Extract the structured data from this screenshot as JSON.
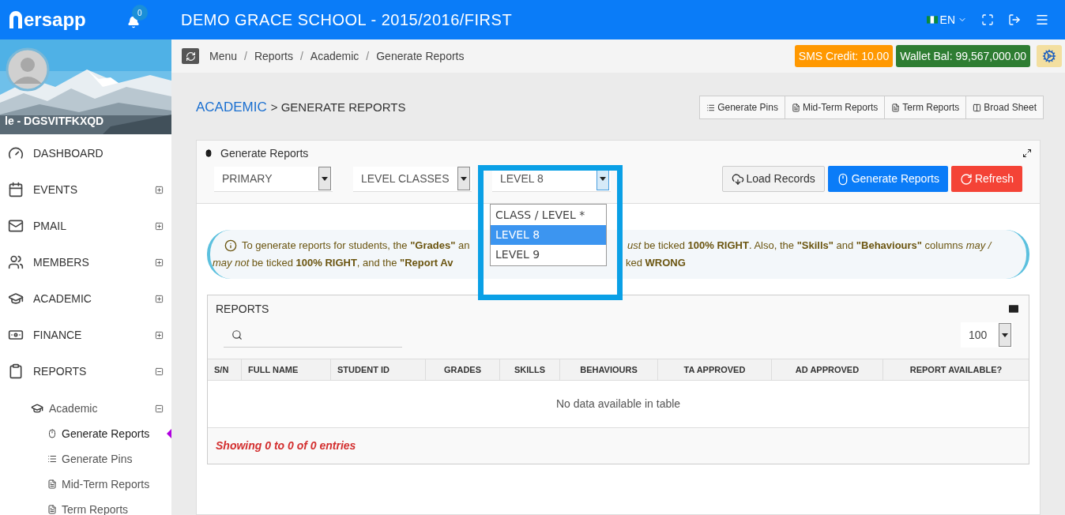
{
  "topbar": {
    "logo": "ersapp",
    "notifications": "0",
    "title": "DEMO GRACE SCHOOL - 2015/2016/FIRST",
    "language": "EN"
  },
  "breadcrumb": [
    "Menu",
    "/",
    "Reports",
    "/",
    "Academic",
    "/",
    "Generate Reports"
  ],
  "balances": [
    {
      "label": "SMS Credit: 10.00",
      "color": "#ff9800"
    },
    {
      "label": "Wallet Bal: 99,567,000.00",
      "color": "#2e7d32"
    }
  ],
  "sidebar": {
    "user": "le - DGSVITFKXQD",
    "items": [
      {
        "kind": "dashboard",
        "label": "DASHBOARD"
      },
      {
        "kind": "calendar",
        "label": "EVENTS",
        "expanded": false
      },
      {
        "kind": "mail",
        "label": "PMAIL",
        "expanded": false
      },
      {
        "kind": "users",
        "label": "MEMBERS",
        "expanded": false
      },
      {
        "kind": "cap",
        "label": "ACADEMIC",
        "expanded": false
      },
      {
        "kind": "money",
        "label": "FINANCE",
        "expanded": false
      },
      {
        "kind": "clipboard",
        "label": "REPORTS",
        "expanded": true,
        "children": [
          {
            "kind": "cap",
            "label": "Academic",
            "expanded": true,
            "children": [
              {
                "kind": "mouse",
                "label": "Generate Reports",
                "selected": true
              },
              {
                "kind": "list",
                "label": "Generate Pins",
                "selected": false
              },
              {
                "kind": "doc",
                "label": "Mid-Term Reports",
                "selected": false
              },
              {
                "kind": "doc",
                "label": "Term Reports",
                "selected": false
              }
            ]
          }
        ]
      }
    ]
  },
  "heading": {
    "section": "ACADEMIC",
    "page": "> GENERATE REPORTS"
  },
  "report_buttons": [
    {
      "kind": "list",
      "label": "Generate Pins"
    },
    {
      "kind": "doc",
      "label": "Mid-Term Reports"
    },
    {
      "kind": "doc",
      "label": "Term Reports"
    },
    {
      "kind": "columns",
      "label": "Broad Sheet"
    }
  ],
  "panel": {
    "title": "Generate Reports",
    "selects": [
      {
        "value": "PRIMARY",
        "open": false
      },
      {
        "value": "LEVEL CLASSES",
        "open": false
      },
      {
        "value": "LEVEL 8",
        "open": true
      }
    ],
    "options": [
      {
        "label": "CLASS / LEVEL *",
        "selected": false
      },
      {
        "label": "LEVEL 8",
        "selected": true
      },
      {
        "label": "LEVEL 9",
        "selected": false
      }
    ],
    "actions": [
      {
        "kind": "load",
        "label": "Load Records"
      },
      {
        "kind": "generate",
        "label": "Generate Reports"
      },
      {
        "kind": "refresh",
        "label": "Refresh"
      }
    ],
    "info": [
      [
        "To generate reports for students, the **\"Grades\"** an",
        "*ust* be ticked **100% RIGHT**. Also, the **\"Skills\"** and **\"Behaviours\"** columns *may /*"
      ],
      [
        "*may not* be ticked **100% RIGHT**, and the **\"Report Av**",
        "ked **WRONG**"
      ]
    ]
  },
  "reports": {
    "title": "REPORTS",
    "page_size": "100",
    "columns": [
      "S/N",
      "FULL NAME",
      "STUDENT ID",
      "GRADES",
      "SKILLS",
      "BEHAVIOURS",
      "TA APPROVED",
      "AD APPROVED",
      "REPORT AVAILABLE?"
    ],
    "empty": "No data available in table",
    "footer": "Showing 0 to 0 of 0 entries"
  }
}
